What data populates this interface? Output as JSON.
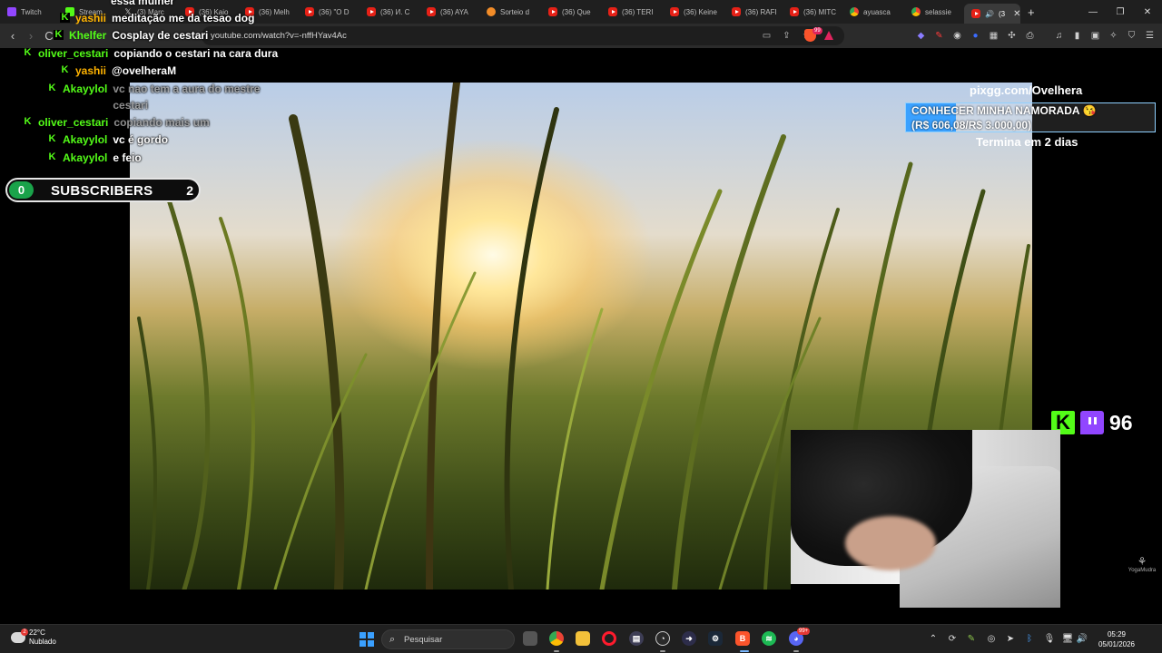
{
  "browser": {
    "tabs": [
      {
        "label": "Twitch",
        "icon": "twitch-icon"
      },
      {
        "label": "Stream",
        "icon": "kick-icon"
      },
      {
        "label": "(3) Marc",
        "icon": "x-icon"
      },
      {
        "label": "(36) Kaio",
        "icon": "youtube-icon"
      },
      {
        "label": "(36) Melh",
        "icon": "youtube-icon"
      },
      {
        "label": "(36) \"O D",
        "icon": "youtube-icon"
      },
      {
        "label": "(36) И. С",
        "icon": "youtube-icon"
      },
      {
        "label": "(36) AYA",
        "icon": "youtube-icon"
      },
      {
        "label": "Sorteio d",
        "icon": "orange-circle-icon"
      },
      {
        "label": "(36) Que",
        "icon": "youtube-icon"
      },
      {
        "label": "(36) TERI",
        "icon": "youtube-icon"
      },
      {
        "label": "(36) Keine",
        "icon": "youtube-icon"
      },
      {
        "label": "(36) RAFI",
        "icon": "youtube-icon"
      },
      {
        "label": "(36) MITC",
        "icon": "youtube-icon"
      },
      {
        "label": "ayuasca",
        "icon": "google-icon"
      },
      {
        "label": "selassie",
        "icon": "google-icon"
      },
      {
        "label": "(3",
        "icon": "youtube-icon",
        "active": true
      }
    ],
    "new_tab": "+",
    "url": "youtube.com/watch?v=-nffHYav4Ac",
    "brave_badge": "99"
  },
  "chat": [
    {
      "user": "",
      "message": "essa mulher",
      "badge": false,
      "user_color": "",
      "faded": false
    },
    {
      "user": "yashii",
      "message": "meditação me da tesao dog",
      "badge": true,
      "user_color": "orange",
      "faded": false
    },
    {
      "user": "Khelfer",
      "message": "Cosplay de cestari",
      "badge": true,
      "user_color": "green",
      "faded": false
    },
    {
      "user": "oliver_cestari",
      "message": "copiando o cestari na cara dura",
      "badge": true,
      "user_color": "green",
      "faded": false
    },
    {
      "user": "yashii",
      "message": "@ovelheraM",
      "badge": true,
      "user_color": "orange",
      "faded": false
    },
    {
      "user": "Akayylol",
      "message": "vc nao tem a aura do mestre",
      "message2": "cestari",
      "badge": true,
      "user_color": "green",
      "faded": true
    },
    {
      "user": "oliver_cestari",
      "message": "copiando mais um",
      "badge": true,
      "user_color": "green",
      "faded": false
    },
    {
      "user": "Akayylol",
      "message": "vc é gordo",
      "badge": true,
      "user_color": "green",
      "faded": false
    },
    {
      "user": "Akayylol",
      "message": "e feio",
      "badge": true,
      "user_color": "green",
      "faded": false
    }
  ],
  "subscribers": {
    "current": "0",
    "label": "SUBSCRIBERS",
    "goal": "2"
  },
  "pix_goal": {
    "site": "pixgg.com/Ovelhera",
    "title": "CONHECER MINHA NAMORADA 😘",
    "amount": "(R$ 606,08/R$ 3.000,00)",
    "progress": 0.202,
    "ends": "Termina em 2 dias"
  },
  "viewers": {
    "count": "96"
  },
  "watermark": "YogaMudra",
  "taskbar": {
    "weather_temp": "22°C",
    "weather_desc": "Nublado",
    "weather_badge": "2",
    "search_placeholder": "Pesquisar",
    "discord_badge": "99+",
    "time": "05:29",
    "date": "05/01/2026"
  },
  "colors": {
    "kick_green": "#53fc18",
    "twitch_purple": "#9146ff",
    "pix_blue": "#3aa1ff",
    "orange_name": "#ffb300"
  }
}
